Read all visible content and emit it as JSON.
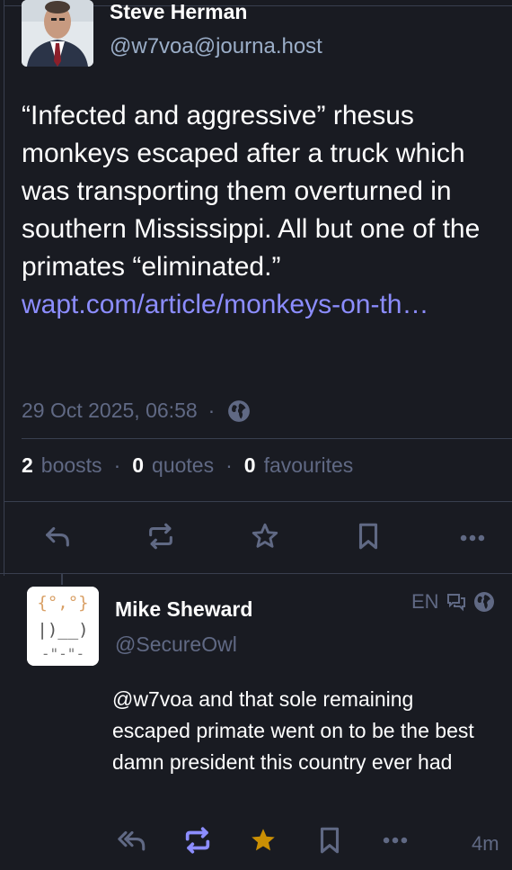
{
  "main_status": {
    "display_name": "Steve Herman",
    "account": "@w7voa@journa.host",
    "content": "“Infected and aggressive” rhesus monkeys escaped after a truck which was transporting them overturned in southern Mississippi. All but one of the primates “eliminated.”",
    "link": "wapt.com/article/monkeys-on-th…",
    "timestamp": "29 Oct 2025, 06:58",
    "separator": "·",
    "visibility_icon": "globe-icon",
    "stats": {
      "boosts_count": "2",
      "boosts_label": "boosts",
      "quotes_count": "0",
      "quotes_label": "quotes",
      "favourites_count": "0",
      "favourites_label": "favourites"
    },
    "actions": [
      "reply-icon",
      "boost-icon",
      "favourite-icon",
      "bookmark-icon",
      "more-icon"
    ]
  },
  "reply": {
    "avatar_art": [
      "{°,°}",
      "|)__)",
      "-\"-\"-"
    ],
    "display_name": "Mike Sheward",
    "account": "@SecureOwl",
    "language": "EN",
    "mention": "@w7voa",
    "content": " and that sole remaining escaped primate went on to be the best damn president this country ever had",
    "relative_time": "4m",
    "actions": [
      "reply-all-icon",
      "boost-icon",
      "favourite-icon",
      "bookmark-icon",
      "more-icon"
    ],
    "boosted": true,
    "favourited": true
  },
  "colors": {
    "background": "#191b22",
    "text": "#ffffff",
    "muted": "#606984",
    "link": "#8c8dff",
    "boost_active": "#8c8dff",
    "favourite_active": "#ca8f04",
    "border": "#393f4f"
  }
}
